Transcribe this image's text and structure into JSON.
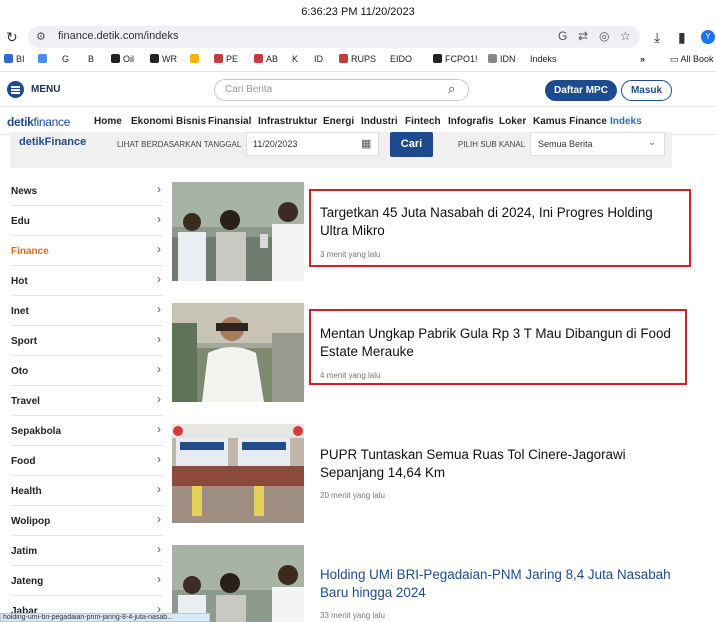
{
  "timestamp": "6:36:23 PM 11/20/2023",
  "browser": {
    "url": "finance.detik.com/indeks",
    "bookmarks": [
      {
        "label": "BI",
        "color": "#2e6bd6"
      },
      {
        "label": "",
        "color": "#4a8cf0"
      },
      {
        "label": "G",
        "color": ""
      },
      {
        "label": "B",
        "color": ""
      },
      {
        "label": "Oil",
        "color": "#222"
      },
      {
        "label": "WR",
        "color": "#222"
      },
      {
        "label": "",
        "color": "#f2b400"
      },
      {
        "label": "PE",
        "color": "#c43c3c"
      },
      {
        "label": "AB",
        "color": "#c43c3c"
      },
      {
        "label": "K",
        "color": ""
      },
      {
        "label": "ID",
        "color": ""
      },
      {
        "label": "RUPS",
        "color": "#c43c3c"
      },
      {
        "label": "EIDO",
        "color": ""
      },
      {
        "label": "FCPO1!",
        "color": "#222"
      },
      {
        "label": "IDN",
        "color": "#888"
      },
      {
        "label": "Indeks",
        "color": ""
      }
    ],
    "bookmarks_more": "»",
    "all_bookmarks": "All Book"
  },
  "header": {
    "menu_label": "MENU",
    "search_placeholder": "Cari Berita",
    "daftar_label": "Daftar MPC",
    "masuk_label": "Masuk"
  },
  "nav": {
    "logo_bold": "detik",
    "logo_rest": "finance",
    "links": [
      "Home",
      "Ekonomi Bisnis",
      "Finansial",
      "Infrastruktur",
      "Energi",
      "Industri",
      "Fintech",
      "Infografis",
      "Loker",
      "Kamus Finance",
      "Indeks"
    ],
    "active": "Indeks"
  },
  "filter": {
    "logo": "detikFinance",
    "date_label": "LIHAT BERDASARKAN TANGGAL",
    "date_value": "11/20/2023",
    "cari_label": "Cari",
    "kanal_label": "PILIH SUB KANAL",
    "kanal_value": "Semua Berita"
  },
  "sidebar": {
    "items": [
      "News",
      "Edu",
      "Finance",
      "Hot",
      "Inet",
      "Sport",
      "Oto",
      "Travel",
      "Sepakbola",
      "Food",
      "Health",
      "Wolipop",
      "Jatim",
      "Jateng",
      "Jabar"
    ],
    "active": "Finance"
  },
  "articles": [
    {
      "title": "Targetkan 45 Juta Nasabah di 2024, Ini Progres Holding Ultra Mikro",
      "time": "3 menit yang lalu",
      "highlighted": true,
      "visited": false
    },
    {
      "title": "Mentan Ungkap Pabrik Gula Rp 3 T Mau Dibangun di Food Estate Merauke",
      "time": "4 menit yang lalu",
      "highlighted": true,
      "visited": false
    },
    {
      "title": "PUPR Tuntaskan Semua Ruas Tol Cinere-Jagorawi Sepanjang 14,64 Km",
      "time": "20 menit yang lalu",
      "highlighted": false,
      "visited": false
    },
    {
      "title": "Holding UMi BRI-Pegadaian-PNM Jaring 8,4 Juta Nasabah Baru hingga 2024",
      "time": "33 menit yang lalu",
      "highlighted": false,
      "visited": true
    }
  ],
  "status_bar": "holding-umi-bri-pegadaian-pnm-jaring-8-4-juta-nasab..."
}
